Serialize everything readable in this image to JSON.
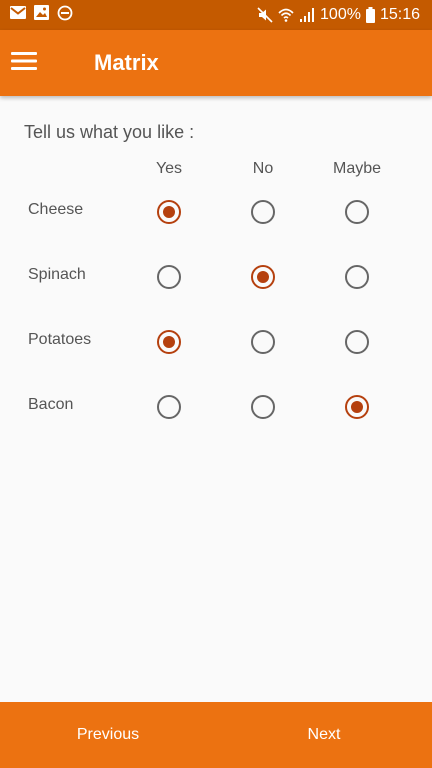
{
  "status_bar": {
    "left_icons": [
      "gmail-icon",
      "gallery-icon",
      "do-not-disturb-icon"
    ],
    "right_icons": [
      "mute-icon",
      "wifi-icon",
      "signal-icon",
      "battery-icon"
    ],
    "battery": "100%",
    "time": "15:16",
    "background": "#c45a00"
  },
  "app_bar": {
    "title": "Matrix",
    "menu_icon": "hamburger-menu-icon",
    "background": "#ec7211"
  },
  "question": "Tell us what you like :",
  "columns": [
    "Yes",
    "No",
    "Maybe"
  ],
  "rows": [
    {
      "label": "Cheese",
      "selected": "Yes"
    },
    {
      "label": "Spinach",
      "selected": "No"
    },
    {
      "label": "Potatoes",
      "selected": "Yes"
    },
    {
      "label": "Bacon",
      "selected": "Maybe"
    }
  ],
  "colors": {
    "accent": "#b5400e",
    "text": "#555555"
  },
  "bottom_nav": {
    "previous": "Previous",
    "next": "Next"
  }
}
